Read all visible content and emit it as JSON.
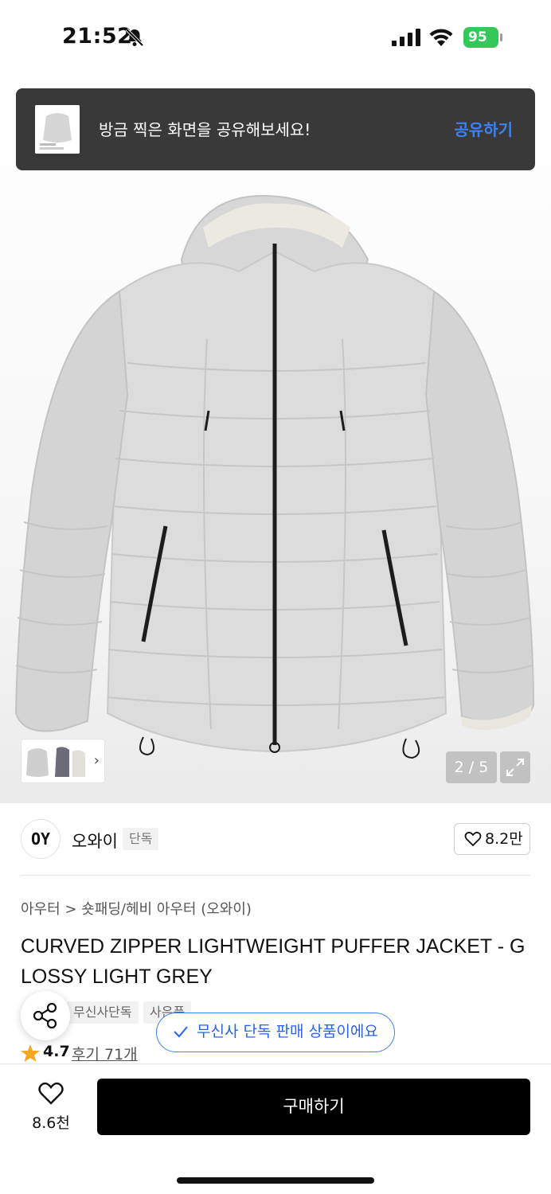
{
  "status_bar": {
    "time": "21:52",
    "battery": "95",
    "icons": [
      "bell-slash-icon",
      "signal-icon",
      "wifi-icon",
      "battery-charging-icon"
    ]
  },
  "share_toast": {
    "message": "방금 찍은 화면을 공유해보세요!",
    "action": "공유하기",
    "action_color": "#3b82f6"
  },
  "gallery": {
    "page_indicator": "2 / 5",
    "expand_icon": "expand-icon",
    "thumb_chevron": "›",
    "product_color": "#dcdcdc"
  },
  "brand": {
    "logo_text": "OY",
    "name": "오와이",
    "badge": "단독",
    "like_count": "8.2만"
  },
  "product": {
    "breadcrumb": "아우터 > 숏패딩/헤비 아우터 (오와이)",
    "title": "CURVED ZIPPER LIGHTWEIGHT PUFFER JACKET - GLOSSY LIGHT GREY",
    "tags": [
      "무신사단독",
      "사은품"
    ],
    "rating": "4.7",
    "reviews": "후기 71개",
    "exclusive_notice": "무신사 단독 판매 상품이에요"
  },
  "bottom_bar": {
    "wish_count": "8.6천",
    "buy_label": "구매하기"
  }
}
